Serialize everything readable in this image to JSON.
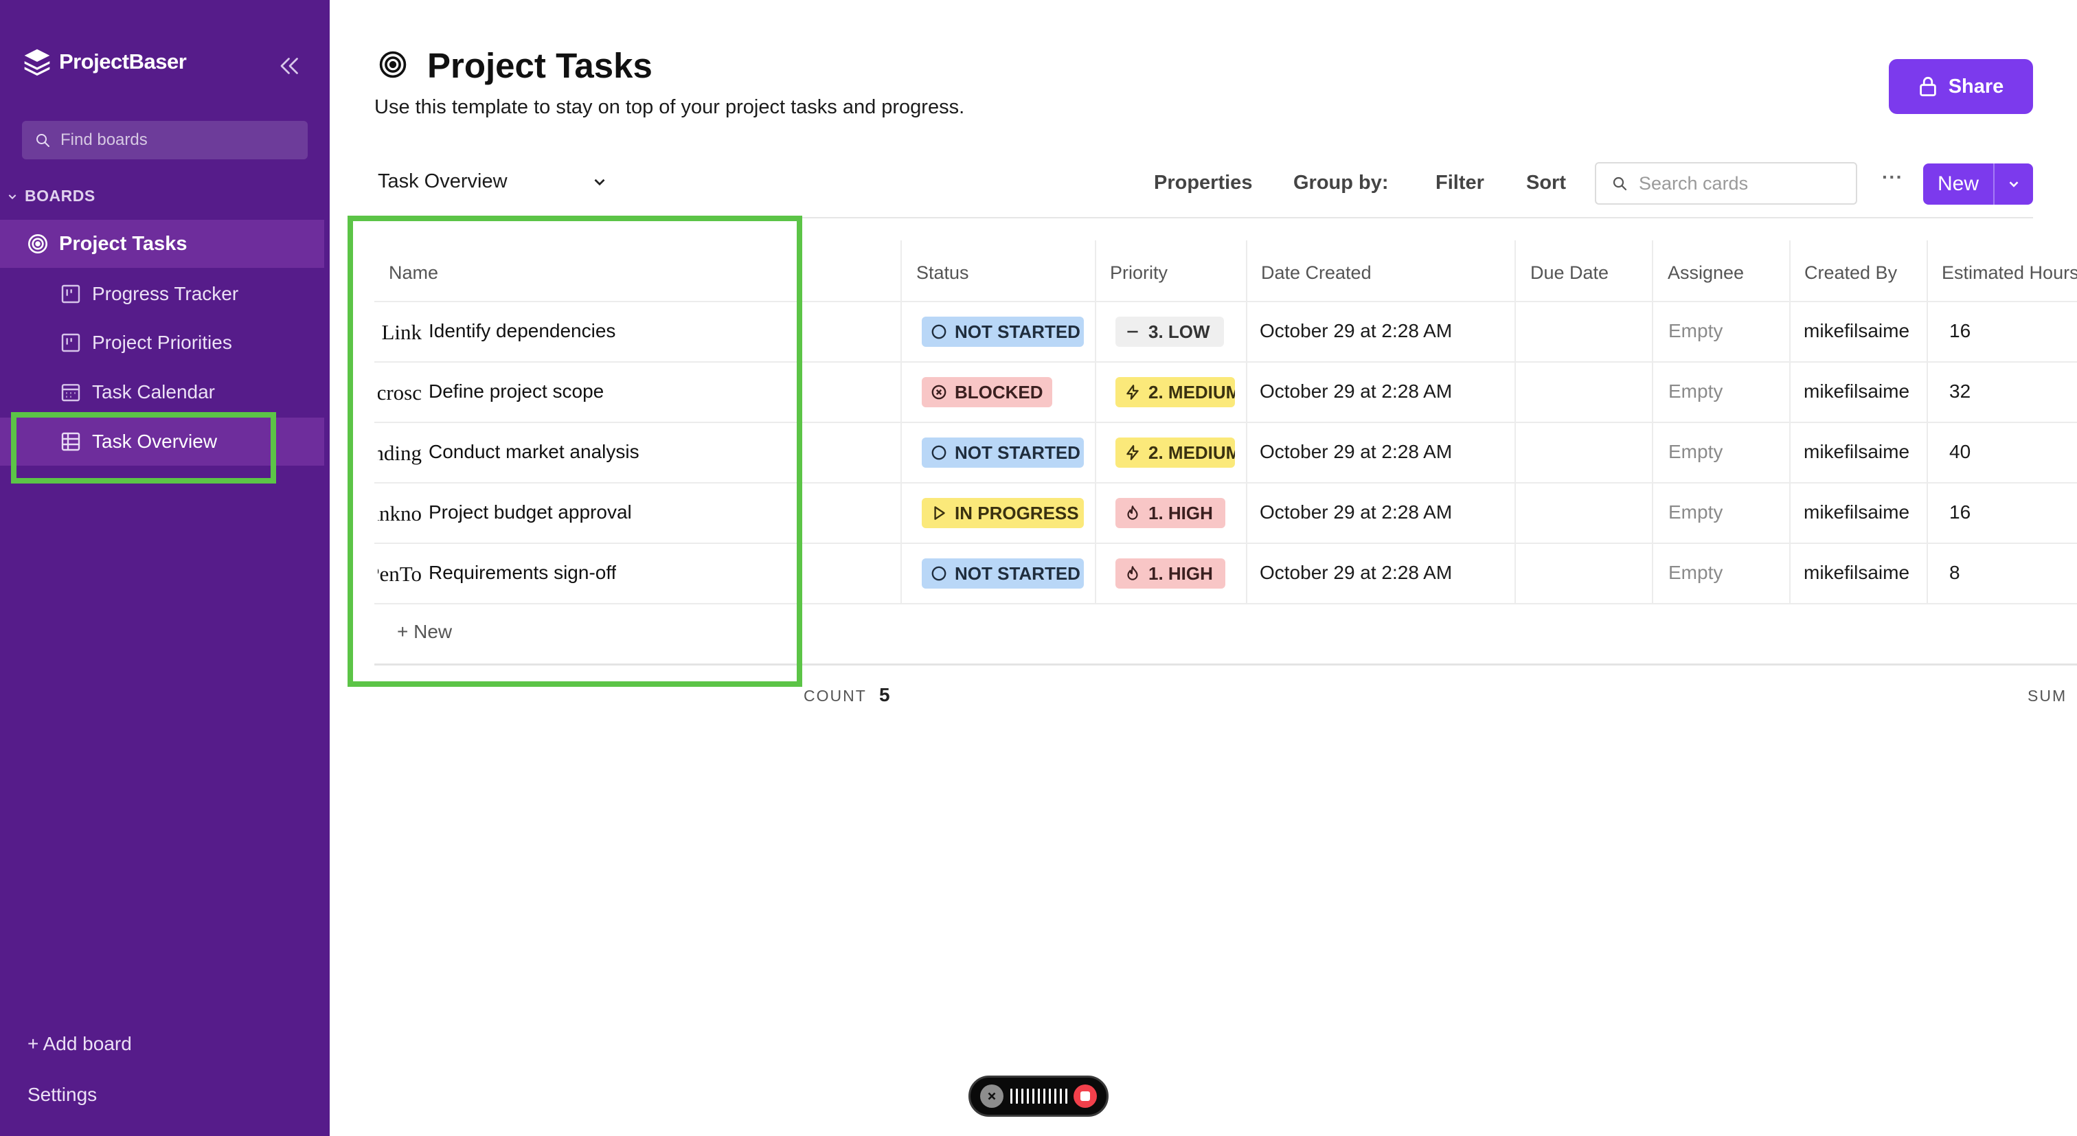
{
  "app": {
    "name": "ProjectBaser"
  },
  "sidebar": {
    "search_placeholder": "Find boards",
    "section_label": "BOARDS",
    "board": {
      "label": "Project Tasks",
      "icon": "target-icon"
    },
    "views": [
      {
        "label": "Progress Tracker",
        "icon": "board-icon"
      },
      {
        "label": "Project Priorities",
        "icon": "board-icon"
      },
      {
        "label": "Task Calendar",
        "icon": "calendar-icon"
      },
      {
        "label": "Task Overview",
        "icon": "table-icon",
        "active": true
      }
    ],
    "add_board": "+ Add board",
    "settings": "Settings"
  },
  "header": {
    "title": "Project Tasks",
    "subtitle": "Use this template to stay on top of your project tasks and progress.",
    "share_label": "Share"
  },
  "toolbar": {
    "view_name": "Task Overview",
    "properties": "Properties",
    "group_by": "Group by:",
    "filter": "Filter",
    "sort": "Sort",
    "search_placeholder": "Search cards",
    "more": "···",
    "new_label": "New"
  },
  "table": {
    "columns": [
      "Name",
      "Status",
      "Priority",
      "Date Created",
      "Due Date",
      "Assignee",
      "Created By",
      "Estimated Hours"
    ],
    "rows": [
      {
        "icon": "Link",
        "name": "Identify dependencies",
        "status": "NOT STARTED",
        "priority": "3. LOW",
        "date_created": "October 29 at 2:28 AM",
        "due_date": "",
        "assignee": "Empty",
        "created_by": "mikefilsaime",
        "hours": "16"
      },
      {
        "icon": "Microsc",
        "name": "Define project scope",
        "status": "BLOCKED",
        "priority": "2. MEDIUM",
        "date_created": "October 29 at 2:28 AM",
        "due_date": "",
        "assignee": "Empty",
        "created_by": "mikefilsaime",
        "hours": "32"
      },
      {
        "icon": "Trending",
        "name": "Conduct market analysis",
        "status": "NOT STARTED",
        "priority": "2. MEDIUM",
        "date_created": "October 29 at 2:28 AM",
        "due_date": "",
        "assignee": "Empty",
        "created_by": "mikefilsaime",
        "hours": "40"
      },
      {
        "icon": "Bankno",
        "name": "Project budget approval",
        "status": "IN PROGRESS",
        "priority": "1. HIGH",
        "date_created": "October 29 at 2:28 AM",
        "due_date": "",
        "assignee": "Empty",
        "created_by": "mikefilsaime",
        "hours": "16"
      },
      {
        "icon": "PenTo",
        "name": "Requirements sign-off",
        "status": "NOT STARTED",
        "priority": "1. HIGH",
        "date_created": "October 29 at 2:28 AM",
        "due_date": "",
        "assignee": "Empty",
        "created_by": "mikefilsaime",
        "hours": "8"
      }
    ],
    "new_row": "+ New",
    "count_label": "COUNT",
    "count_value": "5",
    "sum_label": "SUM"
  },
  "colors": {
    "sidebar_bg": "#561c8a",
    "accent": "#7c3aed",
    "highlight": "#5cc447",
    "status_not_started": "#b9d7f7",
    "status_blocked": "#f8c6c6",
    "status_in_progress": "#fbe97a"
  }
}
